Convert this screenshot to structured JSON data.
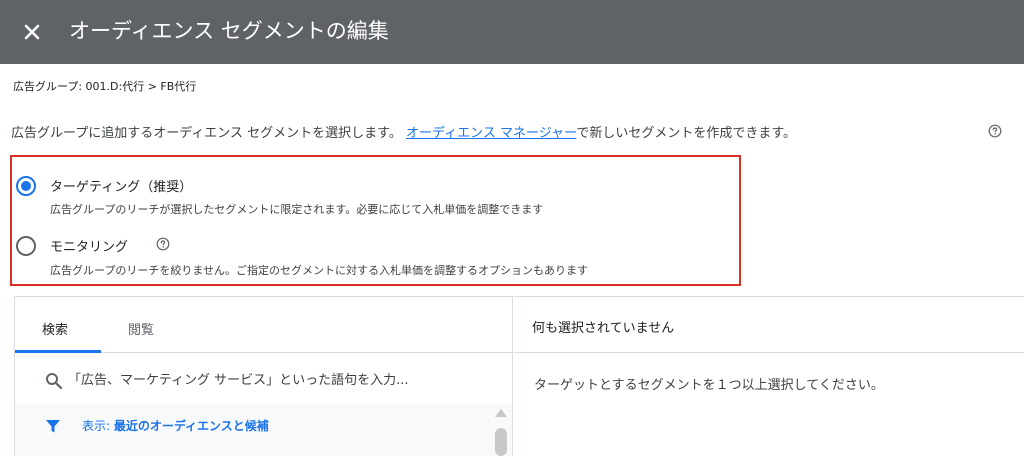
{
  "header": {
    "title": "オーディエンス セグメントの編集",
    "close_icon": "close-icon",
    "background": "#5f6368"
  },
  "breadcrumb": {
    "text": "広告グループ: 001.D:代行 > FB代行"
  },
  "description": {
    "before_link": "広告グループに追加するオーディエンス セグメントを選択します。",
    "link": "オーディエンス マネージャー",
    "after_link": "で新しいセグメントを作成できます。"
  },
  "options": [
    {
      "label": "ターゲティング（推奨）",
      "description": "広告グループのリーチが選択したセグメントに限定されます。必要に応じて入札単価を調整できます",
      "checked": true
    },
    {
      "label": "モニタリング",
      "description": "広告グループのリーチを絞りません。ご指定のセグメントに対する入札単価を調整するオプションもあります",
      "checked": false
    }
  ],
  "tabs": [
    {
      "label": "検索",
      "active": true
    },
    {
      "label": "閲覧",
      "active": false
    }
  ],
  "search": {
    "placeholder": "「広告、マーケティング サービス」といった語句を入力..."
  },
  "filter": {
    "prefix": "表示: ",
    "value": "最近のオーディエンスと候補"
  },
  "selection": {
    "header": "何も選択されていません",
    "hint": "ターゲットとするセグメントを１つ以上選択してください。"
  },
  "colors": {
    "accent": "#1a73e8",
    "highlight_border": "#d93025"
  }
}
